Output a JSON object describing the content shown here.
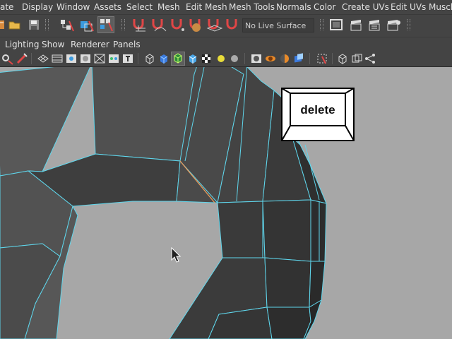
{
  "menubar": {
    "items": [
      {
        "label": "ate"
      },
      {
        "label": "Display"
      },
      {
        "label": "Window"
      },
      {
        "label": "Assets"
      },
      {
        "label": "Select"
      },
      {
        "label": "Mesh"
      },
      {
        "label": "Edit Mesh"
      },
      {
        "label": "Mesh Tools"
      },
      {
        "label": "Normals"
      },
      {
        "label": "Color"
      },
      {
        "label": "Create UVs"
      },
      {
        "label": "Edit UVs"
      },
      {
        "label": "Muscle"
      }
    ]
  },
  "status_line": {
    "live_surface": "No Live Surface"
  },
  "panel_menu": {
    "items": [
      {
        "label": "Lighting"
      },
      {
        "label": "Show"
      },
      {
        "label": "Renderer"
      },
      {
        "label": "Panels"
      }
    ]
  },
  "keycap": {
    "label": "delete"
  },
  "colors": {
    "ui_background": "#444444",
    "menu_text": "#e2e2e2",
    "viewport_background": "#a7a7a7",
    "wireframe_highlight": "#5fd6ec",
    "selected_edge": "#e89a5a"
  },
  "icons": [
    "new-scene-icon",
    "open-scene-icon",
    "save-scene-icon",
    "select-hierarchy-icon",
    "select-object-icon",
    "select-component-icon",
    "snap-to-grid-icon",
    "snap-to-curve-icon",
    "snap-to-point-icon",
    "snap-to-projected-center-icon",
    "snap-to-view-plane-icon",
    "make-live-icon",
    "render-settings-icon",
    "render-current-frame-icon",
    "ipr-render-icon",
    "hypershade-icon",
    "camera-select-icon",
    "camera-attributes-icon",
    "grid-icon",
    "film-gate-icon",
    "resolution-gate-icon",
    "gate-mask-icon",
    "field-chart-icon",
    "safe-action-icon",
    "safe-title-icon",
    "wireframe-shading-icon",
    "smooth-shading-icon",
    "wireframe-on-shaded-icon",
    "default-material-icon",
    "textured-icon",
    "use-all-lights-icon",
    "shadows-icon",
    "screen-space-ao-icon",
    "motion-blur-icon",
    "anti-aliasing-icon",
    "depth-of-field-icon",
    "isolate-select-icon",
    "xray-icon",
    "xray-active-components-icon",
    "xray-joints-icon",
    "cursor-icon"
  ]
}
